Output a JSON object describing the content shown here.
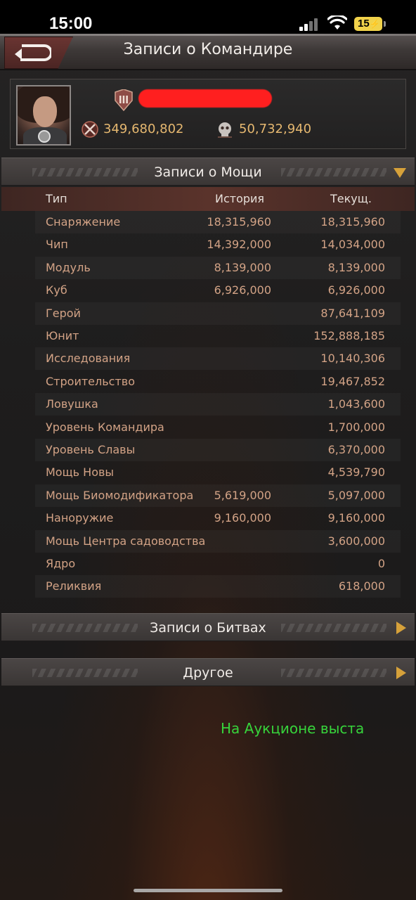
{
  "status_bar": {
    "time": "15:00",
    "battery": "15"
  },
  "header": {
    "title": "Записи о Командире"
  },
  "commander": {
    "stat1": "349,680,802",
    "stat2": "50,732,940"
  },
  "power_section": {
    "title": "Записи о Мощи",
    "columns": {
      "type": "Тип",
      "history": "История",
      "current": "Текущ."
    },
    "rows": [
      {
        "type": "Снаряжение",
        "history": "18,315,960",
        "current": "18,315,960"
      },
      {
        "type": "Чип",
        "history": "14,392,000",
        "current": "14,034,000"
      },
      {
        "type": "Модуль",
        "history": "8,139,000",
        "current": "8,139,000"
      },
      {
        "type": "Куб",
        "history": "6,926,000",
        "current": "6,926,000"
      },
      {
        "type": "Герой",
        "history": "",
        "current": "87,641,109"
      },
      {
        "type": "Юнит",
        "history": "",
        "current": "152,888,185"
      },
      {
        "type": "Исследования",
        "history": "",
        "current": "10,140,306"
      },
      {
        "type": "Строительство",
        "history": "",
        "current": "19,467,852"
      },
      {
        "type": "Ловушка",
        "history": "",
        "current": "1,043,600"
      },
      {
        "type": "Уровень Командира",
        "history": "",
        "current": "1,700,000"
      },
      {
        "type": "Уровень Славы",
        "history": "",
        "current": "6,370,000"
      },
      {
        "type": "Мощь Новы",
        "history": "",
        "current": "4,539,790"
      },
      {
        "type": "Мощь Биомодификатора",
        "history": "5,619,000",
        "current": "5,097,000"
      },
      {
        "type": "Наноружие",
        "history": "9,160,000",
        "current": "9,160,000"
      },
      {
        "type": "Мощь Центра садоводства",
        "history": "",
        "current": "3,600,000"
      },
      {
        "type": "Ядро",
        "history": "",
        "current": "0"
      },
      {
        "type": "Реликвия",
        "history": "",
        "current": "618,000"
      }
    ]
  },
  "battle_section": {
    "title": "Записи о Битвах"
  },
  "other_section": {
    "title": "Другое"
  },
  "ticker": {
    "text": "На Аукционе выста"
  },
  "colors": {
    "accent": "#d6a13a",
    "value_text": "#d3a386",
    "stat_text": "#e6b870",
    "ticker": "#37d43b"
  },
  "icons": {
    "back": "back-arrow-icon",
    "rank": "rank-badge-icon",
    "stat1": "power-icon",
    "stat2": "kills-skull-icon",
    "section_expanded": "triangle-down-icon",
    "section_collapsed": "triangle-right-icon"
  }
}
